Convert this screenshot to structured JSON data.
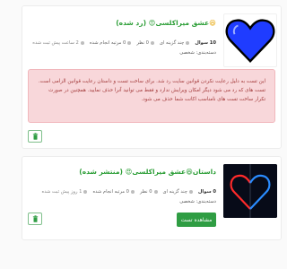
{
  "tests": [
    {
      "emoji": "😆",
      "title": "عشق میراکلسی😍",
      "status_label": "(رد شده)",
      "meta": {
        "questions": "10 سوال",
        "question_type": "چند گزینه ای",
        "views": "0 نظر",
        "completions": "0 مرتبه انجام شده",
        "time_ago": "2 ساعت پیش ثبت شده"
      },
      "category": "دسته‌بندی: شخصی",
      "alert_text": "این تست به دلیل رعایت نکردن قوانین سایت رد شد. برای ساخت تست و داستان رعایت قوانین الزامی است. تست های که رد می شود دیگر امکان ویرایش ندارد و فقط می توانید آنرا حذف نمایید. همچنین در صورت تکرار ساخت تست های نامناسب اکانت شما حذف می شود.",
      "delete_icon": "trash-icon",
      "thumbnail": "blue-heart"
    },
    {
      "title": "داستان😆عشق میراکلسی😍",
      "status_label": "(منتشر شده)",
      "meta": {
        "questions": "0 سوال",
        "question_type": "چند گزینه ای",
        "views": "0 نظر",
        "completions": "0 مرتبه انجام شده",
        "time_ago": "1 روز پیش ثبت شده"
      },
      "category": "دسته‌بندی: شخصی",
      "view_button": "مشاهده تست",
      "delete_icon": "trash-icon",
      "thumbnail": "neon-split-heart"
    }
  ],
  "colors": {
    "accent_green": "#2f9d43",
    "alert_bg": "#f8d7da",
    "alert_text": "#a33a3a",
    "heart_blue": "#1f3cff"
  }
}
